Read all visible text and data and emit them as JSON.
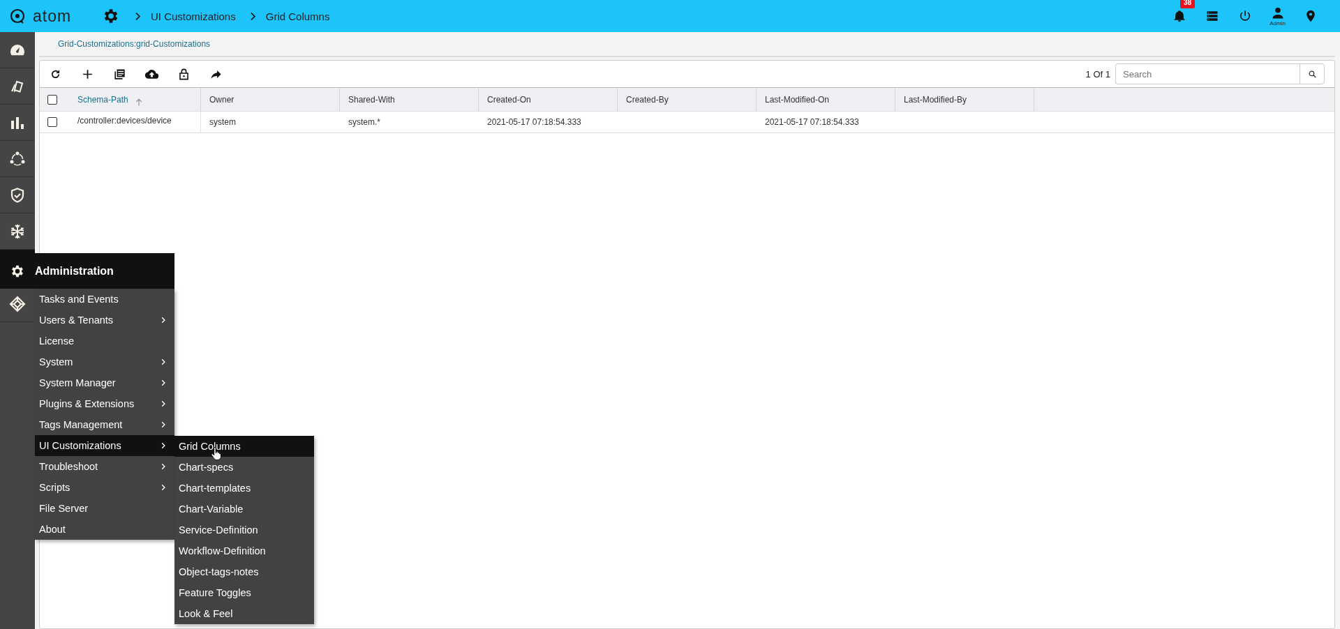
{
  "topbar": {
    "logo": "atom",
    "breadcrumbs": [
      "UI Customizations",
      "Grid Columns"
    ],
    "notification_count": "38",
    "user": "Admin"
  },
  "sidebar": {
    "items": [
      {
        "kind": "gauge",
        "selected": false
      },
      {
        "kind": "cards",
        "selected": false
      },
      {
        "kind": "bars",
        "selected": false
      },
      {
        "kind": "nodes",
        "selected": false
      },
      {
        "kind": "shield",
        "selected": false
      },
      {
        "kind": "snowflake",
        "selected": false
      },
      {
        "kind": "gear",
        "selected": true
      },
      {
        "kind": "cube",
        "selected": false
      }
    ]
  },
  "page_title": "Grid-Customizations:grid-Customizations",
  "toolbar": {
    "pager": "1 Of 1",
    "search": {
      "placeholder": "Search"
    }
  },
  "table": {
    "header_checked": false,
    "columns": [
      {
        "label": "Schema-Path",
        "sorted": true
      },
      {
        "label": "Owner",
        "sorted": false
      },
      {
        "label": "Shared-With",
        "sorted": false
      },
      {
        "label": "Created-On",
        "sorted": false
      },
      {
        "label": "Created-By",
        "sorted": false
      },
      {
        "label": "Last-Modified-On",
        "sorted": false
      },
      {
        "label": "Last-Modified-By",
        "sorted": false
      }
    ],
    "rows": [
      {
        "checked": false,
        "cells": [
          "/controller:devices/device",
          "system",
          "system.*",
          "2021-05-17 07:18:54.333",
          "",
          "2021-05-17 07:18:54.333",
          ""
        ]
      }
    ]
  },
  "admin_menu": {
    "title": "Administration",
    "items": [
      {
        "label": "Tasks and Events",
        "has_submenu": false,
        "selected": false
      },
      {
        "label": "Users & Tenants",
        "has_submenu": true,
        "selected": false
      },
      {
        "label": "License",
        "has_submenu": false,
        "selected": false
      },
      {
        "label": "System",
        "has_submenu": true,
        "selected": false
      },
      {
        "label": "System Manager",
        "has_submenu": true,
        "selected": false
      },
      {
        "label": "Plugins & Extensions",
        "has_submenu": true,
        "selected": false
      },
      {
        "label": "Tags Management",
        "has_submenu": true,
        "selected": false
      },
      {
        "label": "UI Customizations",
        "has_submenu": true,
        "selected": true
      },
      {
        "label": "Troubleshoot",
        "has_submenu": true,
        "selected": false
      },
      {
        "label": "Scripts",
        "has_submenu": true,
        "selected": false
      },
      {
        "label": "File Server",
        "has_submenu": false,
        "selected": false
      },
      {
        "label": "About",
        "has_submenu": false,
        "selected": false
      }
    ]
  },
  "submenu": {
    "items": [
      {
        "label": "Grid Columns",
        "selected": true
      },
      {
        "label": "Chart-specs",
        "selected": false
      },
      {
        "label": "Chart-templates",
        "selected": false
      },
      {
        "label": "Chart-Variable",
        "selected": false
      },
      {
        "label": "Service-Definition",
        "selected": false
      },
      {
        "label": "Workflow-Definition",
        "selected": false
      },
      {
        "label": "Object-tags-notes",
        "selected": false
      },
      {
        "label": "Feature Toggles",
        "selected": false
      },
      {
        "label": "Look & Feel",
        "selected": false
      }
    ]
  }
}
